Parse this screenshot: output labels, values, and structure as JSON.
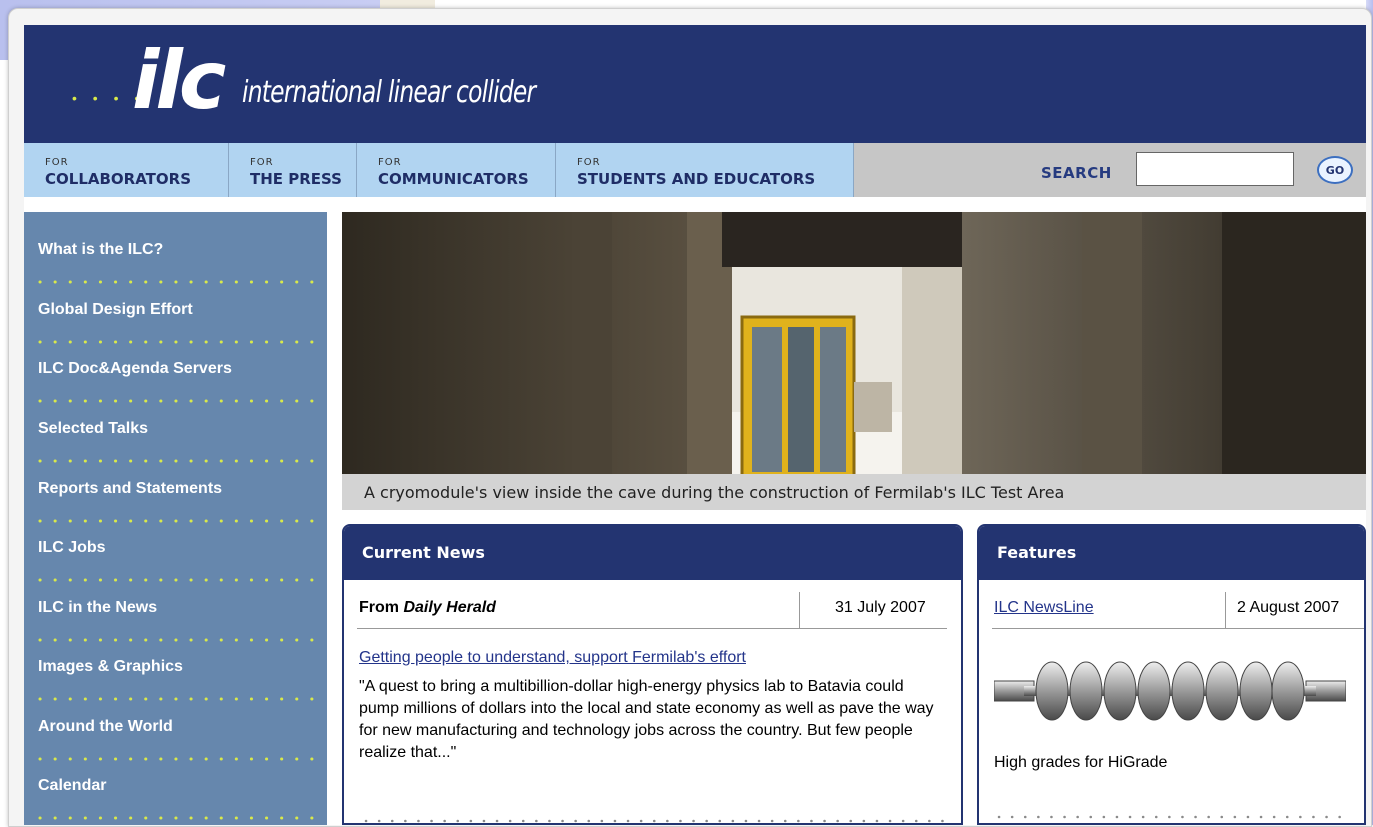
{
  "header": {
    "logo_mark": "ilc",
    "logo_text": "international linear collider"
  },
  "nav": {
    "tabs": [
      {
        "prefix": "FOR",
        "label": "COLLABORATORS"
      },
      {
        "prefix": "FOR",
        "label": "THE PRESS"
      },
      {
        "prefix": "FOR",
        "label": "COMMUNICATORS"
      },
      {
        "prefix": "FOR",
        "label": "STUDENTS AND EDUCATORS"
      }
    ],
    "search_label": "SEARCH",
    "search_value": "",
    "go_label": "GO"
  },
  "sidebar": {
    "items": [
      "What is the ILC?",
      "Global Design Effort",
      "ILC Doc&Agenda Servers",
      "Selected Talks",
      "Reports and Statements",
      "ILC Jobs",
      "ILC in the News",
      "Images & Graphics",
      "Around the World",
      "Calendar"
    ]
  },
  "hero": {
    "caption": "A cryomodule's view inside the cave during the construction of Fermilab's ILC Test Area"
  },
  "news": {
    "title": "Current News",
    "source_prefix": "From ",
    "source_name": "Daily Herald",
    "date": "31 July 2007",
    "headline": "Getting people to understand, support Fermilab's effort",
    "body": "\"A quest to bring a multibillion-dollar high-energy physics lab to Batavia could pump millions of dollars into the local and state economy as well as pave the way for new manufacturing and technology jobs across the country. But few people realize that...\""
  },
  "features": {
    "title": "Features",
    "source": "ILC NewsLine",
    "date": "2 August 2007",
    "caption": "High grades for HiGrade"
  },
  "colors": {
    "brand_navy": "#233471",
    "nav_blue": "#b1d4f1",
    "sidebar_blue": "#6687ad",
    "dot_yellow": "#d9e94a"
  }
}
